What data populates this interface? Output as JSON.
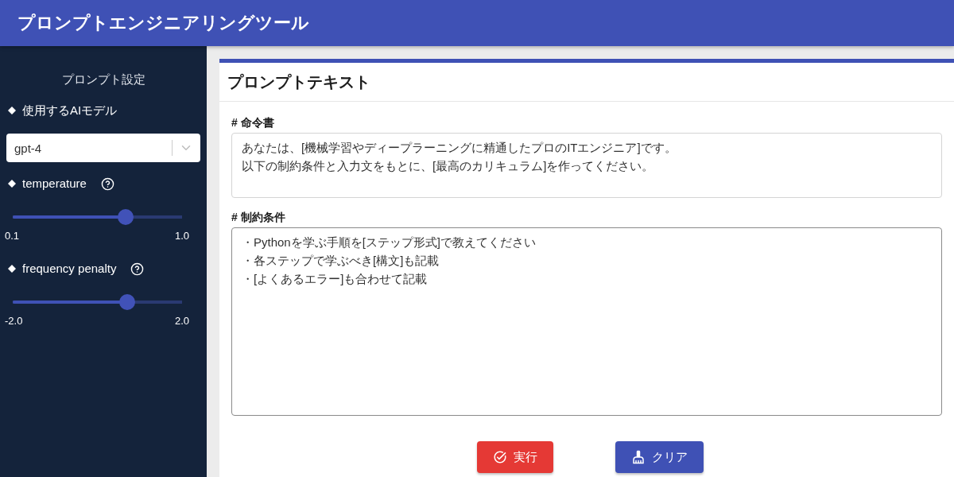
{
  "header": {
    "title": "プロンプトエンジニアリングツール"
  },
  "sidebar": {
    "title": "プロンプト設定",
    "model": {
      "label": "使用するAIモデル",
      "value": "gpt-4"
    },
    "sliders": [
      {
        "label": "temperature",
        "level": 0.667,
        "min": "0.1",
        "max": "1.0"
      },
      {
        "label": "frequency penalty",
        "level": 0.676,
        "min": "-2.0",
        "max": "2.0"
      }
    ]
  },
  "panel": {
    "title": "プロンプトテキスト",
    "fields": [
      {
        "label": "# 命令書",
        "lines": [
          "あなたは、[機械学習やディープラーニングに精通したプロのITエンジニア]です。",
          "以下の制約条件と入力文をもとに、[最高のカリキュラム]を作ってください。"
        ],
        "focused": false
      },
      {
        "label": "# 制約条件",
        "lines": [
          "・Pythonを学ぶ手順を[ステップ形式]で教えてください",
          "・各ステップで学ぶべき[構文]も記載",
          "・[よくあるエラー]も合わせて記載"
        ],
        "focused": true
      }
    ],
    "buttons": [
      {
        "label": "実行",
        "kind": "run"
      },
      {
        "label": "クリア",
        "kind": "clear"
      }
    ]
  }
}
